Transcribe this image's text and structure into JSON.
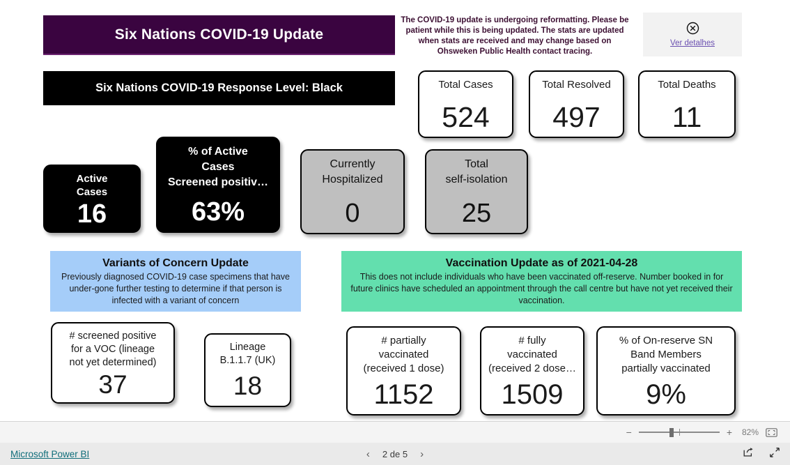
{
  "report": {
    "title": "Six Nations COVID-19 Update",
    "notice": "The COVID-19 update  is undergoing reformatting.  Please be patient while this is being updated. The stats are updated when stats are received and may change based on Ohsweken Public Health contact tracing.",
    "details_link": "Ver detalhes",
    "details_icon": "circle-x-icon",
    "response_level": "Six Nations COVID-19 Response Level: Black"
  },
  "colors": {
    "title_banner": "#3a0440",
    "response_banner": "#000000",
    "voc_header": "#a5cdf9",
    "vax_header": "#63dfae",
    "grey_card": "#bfbfbf",
    "link": "#0f6d7a",
    "details_link": "#6a4fb0"
  },
  "kpis": {
    "total_cases": {
      "label": "Total Cases",
      "value": "524"
    },
    "total_resolved": {
      "label": "Total Resolved",
      "value": "497"
    },
    "total_deaths": {
      "label": "Total Deaths",
      "value": "11"
    },
    "active_cases": {
      "label": "Active\nCases",
      "value": "16"
    },
    "active_screened": {
      "label": "% of Active\nCases\nScreened positiv…",
      "value": "63%"
    },
    "hospitalized": {
      "label": "Currently\nHospitalized",
      "value": "0"
    },
    "self_isolation": {
      "label": "Total\nself-isolation",
      "value": "25"
    },
    "voc_screened": {
      "label": "# screened positive\nfor a VOC (lineage\nnot yet determined)",
      "value": "37"
    },
    "lineage_uk": {
      "label": "Lineage\nB.1.1.7 (UK)",
      "value": "18"
    },
    "partially_vaccinated": {
      "label": "# partially\nvaccinated\n(received 1 dose)",
      "value": "1152"
    },
    "fully_vaccinated": {
      "label": "# fully\nvaccinated\n(received 2 dose…",
      "value": "1509"
    },
    "pct_partially_vaccinated": {
      "label": "% of On-reserve SN\nBand Members\npartially vaccinated",
      "value": "9%"
    }
  },
  "sections": {
    "voc": {
      "heading": "Variants of Concern Update",
      "description": "Previously diagnosed COVID-19 case specimens that have under-gone further testing to determine if that person is infected with a variant of concern"
    },
    "vaccination": {
      "heading": "Vaccination Update as of 2021-04-28",
      "description": "This does not include individuals who have been vaccinated off-reserve. Number booked in for future clinics have scheduled an appointment through the call centre but have not yet received their vaccination."
    }
  },
  "toolbar": {
    "zoom_out": "−",
    "zoom_in": "+",
    "zoom_level": "82%",
    "fit_icon": "fit-to-page-icon"
  },
  "footer": {
    "brand_link": "Microsoft Power BI",
    "prev_icon": "chevron-left-icon",
    "next_icon": "chevron-right-icon",
    "page_indicator": "2 de 5",
    "share_icon": "share-icon",
    "fullscreen_icon": "fullscreen-icon"
  },
  "chart_data": {
    "type": "table",
    "title": "Six Nations COVID-19 Update",
    "categories": [
      "Total Cases",
      "Total Resolved",
      "Total Deaths",
      "Active Cases",
      "% of Active Cases Screened positive",
      "Currently Hospitalized",
      "Total self-isolation",
      "# screened positive for a VOC (lineage not yet determined)",
      "Lineage B.1.1.7 (UK)",
      "# partially vaccinated (received 1 dose)",
      "# fully vaccinated (received 2 doses)",
      "% of On-reserve SN Band Members partially vaccinated"
    ],
    "values": [
      524,
      497,
      11,
      16,
      63,
      0,
      25,
      37,
      18,
      1152,
      1509,
      9
    ],
    "units": [
      "count",
      "count",
      "count",
      "count",
      "percent",
      "count",
      "count",
      "count",
      "count",
      "count",
      "count",
      "percent"
    ],
    "as_of": "2021-04-28"
  }
}
